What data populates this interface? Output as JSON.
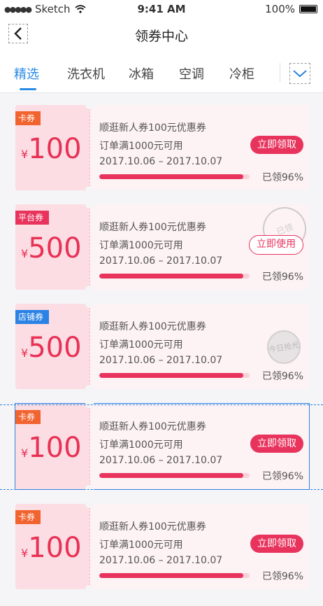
{
  "status": {
    "carrier": "Sketch",
    "time": "9:41 AM",
    "battery": "100%"
  },
  "nav": {
    "title": "领券中心"
  },
  "tabs": [
    "精选",
    "洗衣机",
    "冰箱",
    "空调",
    "冷柜"
  ],
  "coupons": [
    {
      "tag": "卡券",
      "currency": "¥",
      "amount": "100",
      "title": "顺逛新人券100元优惠券",
      "condition": "订单满1000元可用",
      "date": "2017.10.06 – 2017.10.07",
      "progress": 0.96,
      "claimed": "已领96%",
      "action": "立即领取"
    },
    {
      "tag": "平台券",
      "currency": "¥",
      "amount": "500",
      "title": "顺逛新人券100元优惠券",
      "condition": "订单满1000元可用",
      "date": "2017.10.06 – 2017.10.07",
      "progress": 0.96,
      "claimed": "已领96%",
      "action": "立即使用",
      "stamp": "已领"
    },
    {
      "tag": "店铺券",
      "currency": "¥",
      "amount": "500",
      "title": "顺逛新人券100元优惠券",
      "condition": "订单满1000元可用",
      "date": "2017.10.06 – 2017.10.07",
      "progress": 0.96,
      "claimed": "已领96%",
      "stamp": "今日抢光"
    },
    {
      "tag": "卡券",
      "currency": "¥",
      "amount": "100",
      "title": "顺逛新人券100元优惠券",
      "condition": "订单满1000元可用",
      "date": "2017.10.06 – 2017.10.07",
      "progress": 0.96,
      "claimed": "已领96%",
      "action": "立即领取"
    },
    {
      "tag": "卡券",
      "currency": "¥",
      "amount": "100",
      "title": "顺逛新人券100元优惠券",
      "condition": "订单满1000元可用",
      "date": "2017.10.06 – 2017.10.07",
      "progress": 0.96,
      "claimed": "已领96%",
      "action": "立即领取"
    }
  ]
}
